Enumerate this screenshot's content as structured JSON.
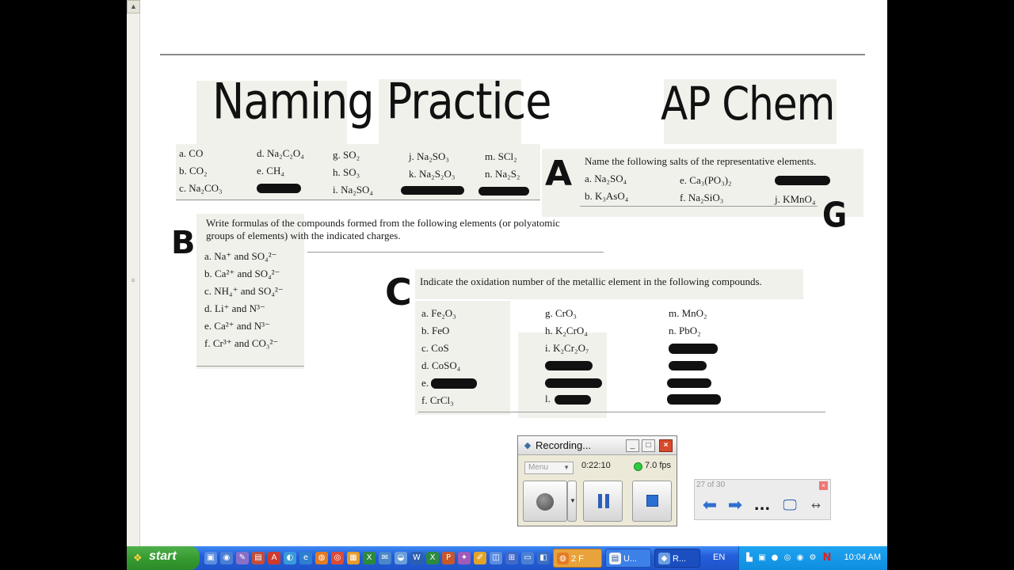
{
  "worksheet": {
    "title": "Naming Practice",
    "course": "AP Chem",
    "section_a": {
      "letter": "A",
      "instruction": "Name the following salts of the representative elements.",
      "left_items": [
        [
          "a. CO",
          "b. CO₂",
          "c. Na₂CO₃"
        ],
        [
          "d. Na₂C₂O₄",
          "e. CH₄"
        ],
        [
          "g. SO₂",
          "h. SO₃",
          "i. Na₂SO₄"
        ],
        [
          "j. Na₂SO₃",
          "k. Na₂S₂O₃"
        ],
        [
          "m. SCl₂",
          "n. Na₂S₂"
        ]
      ],
      "right_items": [
        "a. Na₂SO₄",
        "b. K₃AsO₄",
        "e. Ca₃(PO₃)₂",
        "f. Na₂SiO₃",
        "j. KMnO₄"
      ],
      "annotation": "G"
    },
    "section_b": {
      "letter": "B",
      "instruction": "Write formulas of the compounds formed from the following elements (or polyatomic groups of elements) with the indicated charges.",
      "items": [
        "a. Na⁺ and SO₄²⁻",
        "b. Ca²⁺ and SO₄²⁻",
        "c. NH₄⁺ and SO₄²⁻",
        "d. Li⁺ and N³⁻",
        "e. Ca²⁺ and N³⁻",
        "f. Cr³⁺ and CO₃²⁻"
      ]
    },
    "section_c": {
      "letter": "C",
      "instruction": "Indicate the oxidation number of the metallic element in the following compounds.",
      "col1": [
        "a. Fe₂O₃",
        "b. FeO",
        "c. CoS",
        "d. CoSO₄",
        "e.",
        "f. CrCl₃"
      ],
      "col2": [
        "g. CrO₃",
        "h. K₂CrO₄",
        "i. K₂Cr₂O₇",
        "l."
      ],
      "col3": [
        "m. MnO₂",
        "n. PbO₂"
      ]
    }
  },
  "recorder": {
    "title": "Recording...",
    "menu_label": "Menu",
    "elapsed": "0:22:10",
    "fps": "7.0 fps",
    "minimize": "_",
    "maximize": "□",
    "close": "×"
  },
  "slide_nav": {
    "counter": "27 of 30",
    "more_label": "..."
  },
  "taskbar": {
    "start_label": "start",
    "tasks": [
      {
        "label": "2 F",
        "active": true
      },
      {
        "label": "U...",
        "active": false
      },
      {
        "label": "R...",
        "active": false
      }
    ],
    "language": "EN",
    "clock": "10:04 AM"
  },
  "colors": {
    "taskbar_blue": "#245edb",
    "start_green": "#369b31",
    "tray_blue": "#0f8ee0",
    "close_red": "#d84a2c",
    "nav_arrow_blue": "#2f6fd0"
  }
}
